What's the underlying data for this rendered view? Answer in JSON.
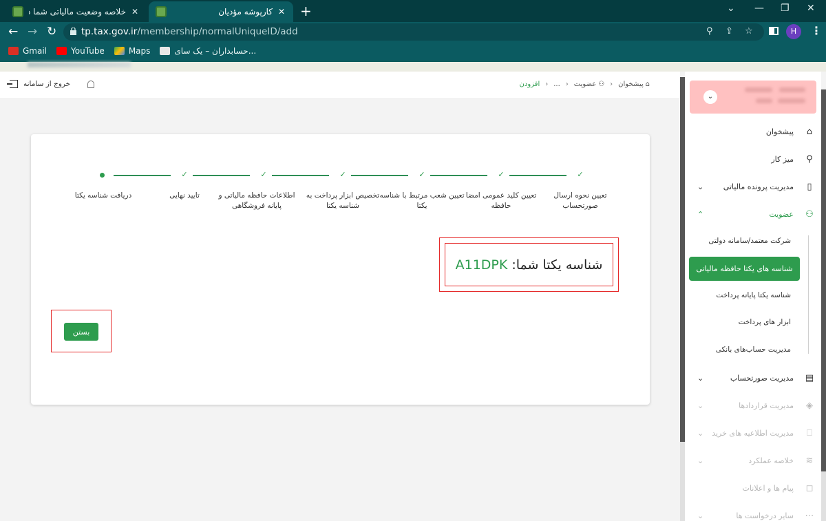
{
  "browser": {
    "tabs": [
      {
        "title": "خلاصه وضعیت مالیاتی شما در نظا",
        "active": false
      },
      {
        "title": "کارپوشه مؤدیان",
        "active": true
      }
    ],
    "new_tab_icon": "+",
    "url_host": "tp.tax.gov.ir",
    "url_path": "/membership/normalUniqueID/add",
    "profile_initial": "H",
    "bookmarks": [
      {
        "label": "Gmail",
        "color": "#d93025"
      },
      {
        "label": "YouTube",
        "color": "#ff0000"
      },
      {
        "label": "Maps",
        "color": "#34a853"
      },
      {
        "label": "حسابداران – یک سای...",
        "color": "#e8e8e8"
      }
    ]
  },
  "topbar": {
    "logout_label": "خروج از سامانه",
    "breadcrumb": [
      {
        "label": "پیشخوان",
        "icon": "home-icon"
      },
      {
        "label": "عضویت",
        "icon": "user-icon"
      },
      {
        "label": "..."
      },
      {
        "label": "افزودن",
        "current": true
      }
    ]
  },
  "stepper": {
    "steps": [
      {
        "label": "تعیین نحوه ارسال صورتحساب",
        "status": "done"
      },
      {
        "label": "تعیین کلید عمومی امضا حافظه",
        "status": "done"
      },
      {
        "label": "تعیین شعب مرتبط با شناسه یکتا",
        "status": "done"
      },
      {
        "label": "تخصیص ابزار پرداخت به شناسه یکتا",
        "status": "done"
      },
      {
        "label": "اطلاعات حافظه مالیاتی و پایانه فروشگاهی",
        "status": "done"
      },
      {
        "label": "تایید نهایی",
        "status": "done"
      },
      {
        "label": "دریافت شناسه یکتا",
        "status": "current"
      }
    ],
    "done_mark": "✓"
  },
  "result": {
    "label": "شناسه یکتا شما:",
    "unique_id": "A11DPK"
  },
  "actions": {
    "close_label": "بستن"
  },
  "sidebar": {
    "items": [
      {
        "label": "پیشخوان",
        "icon": "home-icon",
        "glyph": "⌂"
      },
      {
        "label": "میز کار",
        "icon": "workspace-icon",
        "glyph": "⚲"
      },
      {
        "label": "مدیریت پرونده مالیاتی",
        "icon": "document-icon",
        "glyph": "▯",
        "chevron": "⌄"
      },
      {
        "label": "عضویت",
        "icon": "user-icon",
        "glyph": "⚇",
        "chevron": "⌃",
        "active": true
      },
      {
        "label": "مدیریت صورتحساب",
        "icon": "invoice-icon",
        "glyph": "▤",
        "chevron": "⌄"
      },
      {
        "label": "مدیریت قراردادها",
        "icon": "contract-icon",
        "glyph": "◈",
        "chevron": "⌄",
        "disabled": true
      },
      {
        "label": "مدیریت اطلاعیه های خرید",
        "icon": "shopping-bag-icon",
        "glyph": "⎕",
        "chevron": "⌄",
        "disabled": true
      },
      {
        "label": "خلاصه عملکرد",
        "icon": "performance-icon",
        "glyph": "≋",
        "chevron": "⌄",
        "disabled": true
      },
      {
        "label": "پیام ها و اعلانات",
        "icon": "message-icon",
        "glyph": "◻",
        "disabled": true
      },
      {
        "label": "سایر درخواست ها",
        "icon": "more-requests-icon",
        "glyph": "⋯",
        "chevron": "⌄",
        "disabled": true
      }
    ],
    "membership_subitems": [
      {
        "label": "شرکت معتمد/سامانه دولتی"
      },
      {
        "label": "شناسه های یکتا حافظه مالیاتی",
        "selected": true
      },
      {
        "label": "شناسه یکتا پایانه پرداخت"
      },
      {
        "label": "ابزار های پرداخت"
      },
      {
        "label": "مدیریت حساب‌های بانکی"
      }
    ]
  }
}
